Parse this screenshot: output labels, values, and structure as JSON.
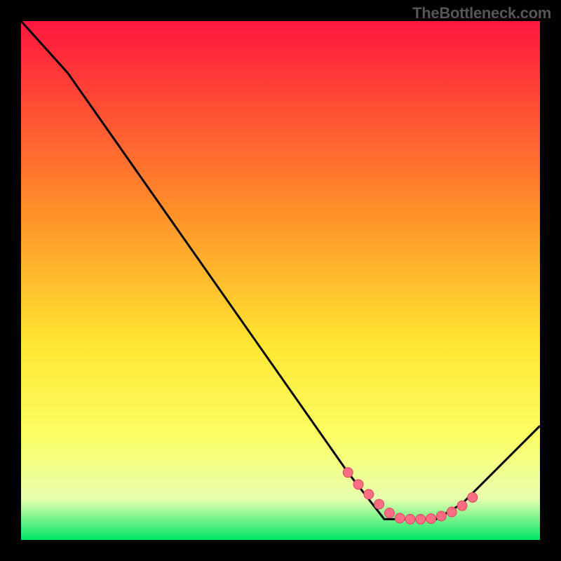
{
  "attribution": "TheBottleneck.com",
  "colors": {
    "gradient_top": "#ff173e",
    "gradient_mid1": "#ff8a2a",
    "gradient_mid2": "#ffe531",
    "gradient_mid3": "#fbff65",
    "gradient_mid4": "#e9ffb0",
    "gradient_bottom": "#00e664",
    "curve": "#000000",
    "marker_fill": "#ff6d82",
    "marker_stroke": "#d94a60",
    "background": "#000000"
  },
  "chart_data": {
    "type": "line",
    "title": "",
    "xlabel": "",
    "ylabel": "",
    "xlim": [
      0,
      100
    ],
    "ylim": [
      0,
      100
    ],
    "series": [
      {
        "name": "curve",
        "x": [
          0,
          9,
          63,
          70,
          80,
          85,
          100
        ],
        "y": [
          100,
          90,
          13,
          4,
          4,
          7,
          22
        ]
      }
    ],
    "markers": {
      "name": "highlight-points",
      "x": [
        63,
        65,
        67,
        69,
        71,
        73,
        75,
        77,
        79,
        81,
        83,
        85,
        87
      ],
      "y": [
        13,
        10.7,
        8.8,
        6.9,
        5.2,
        4.2,
        4.0,
        4.0,
        4.1,
        4.6,
        5.4,
        6.6,
        8.2
      ]
    }
  }
}
